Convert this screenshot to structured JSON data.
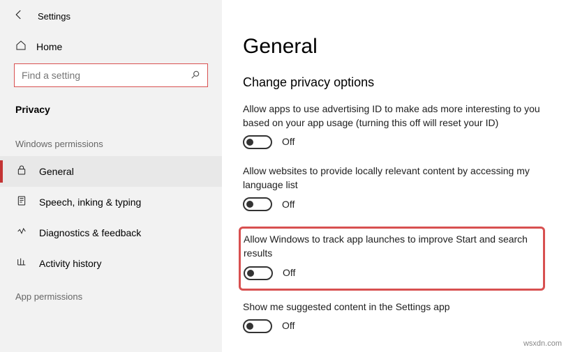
{
  "app": {
    "title": "Settings"
  },
  "sidebar": {
    "home_label": "Home",
    "search_placeholder": "Find a setting",
    "category": "Privacy",
    "section1_label": "Windows permissions",
    "items": [
      {
        "icon": "lock",
        "label": "General",
        "selected": true
      },
      {
        "icon": "speech",
        "label": "Speech, inking & typing",
        "selected": false
      },
      {
        "icon": "diag",
        "label": "Diagnostics & feedback",
        "selected": false
      },
      {
        "icon": "history",
        "label": "Activity history",
        "selected": false
      }
    ],
    "section2_label": "App permissions"
  },
  "main": {
    "heading": "General",
    "subheading": "Change privacy options",
    "options": [
      {
        "desc": "Allow apps to use advertising ID to make ads more interesting to you based on your app usage (turning this off will reset your ID)",
        "state": "Off"
      },
      {
        "desc": "Allow websites to provide locally relevant content by accessing my language list",
        "state": "Off"
      },
      {
        "desc": "Allow Windows to track app launches to improve Start and search results",
        "state": "Off",
        "highlighted": true
      },
      {
        "desc": "Show me suggested content in the Settings app",
        "state": "Off"
      }
    ]
  },
  "watermark": "wsxdn.com"
}
